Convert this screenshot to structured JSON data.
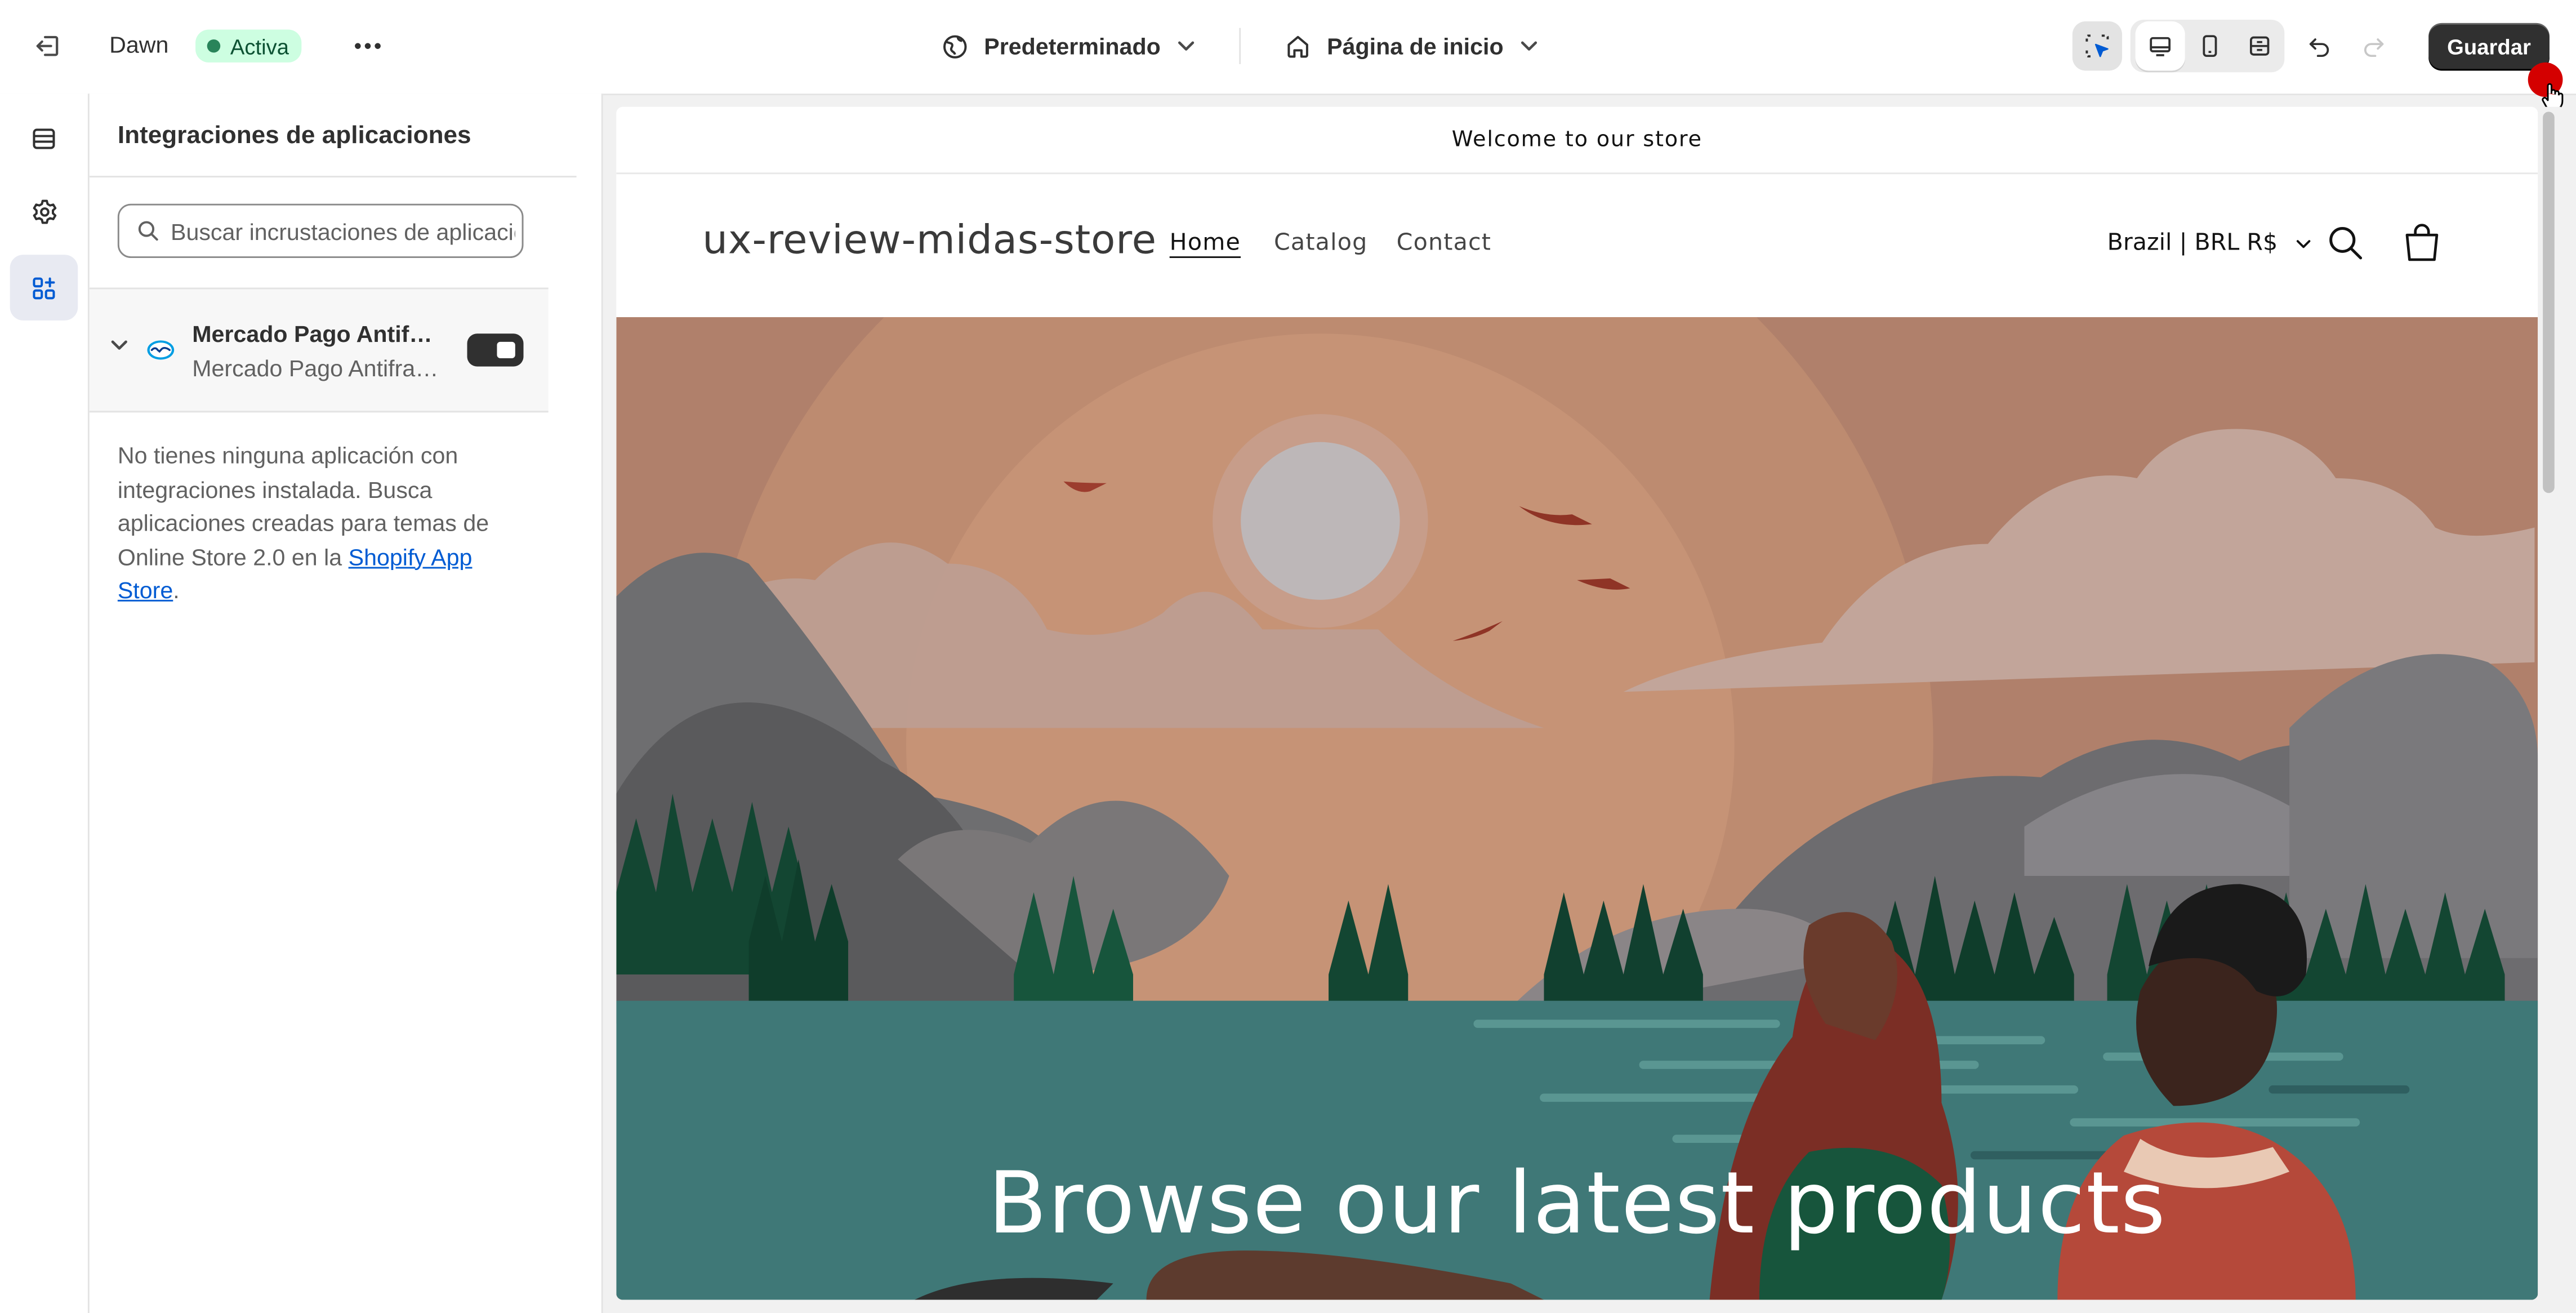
{
  "topbar": {
    "theme_name": "Dawn",
    "status_badge": "Activa",
    "template_dropdown": "Predeterminado",
    "page_dropdown": "Página de inicio",
    "save_label": "Guardar"
  },
  "sidebar_rail": {
    "items": [
      {
        "icon": "sections-icon"
      },
      {
        "icon": "settings-gear-icon"
      },
      {
        "icon": "app-embeds-icon",
        "selected": true
      }
    ]
  },
  "panel": {
    "title": "Integraciones de aplicaciones",
    "search_placeholder": "Buscar incrustaciones de aplicaciones",
    "app": {
      "name": "Mercado Pago Antifraude",
      "subtitle": "Mercado Pago Antifraude",
      "enabled": true
    },
    "empty_text_before": "No tienes ninguna aplicación con integraciones instalada. Busca aplicaciones creadas para temas de Online Store 2.0 en la ",
    "empty_link": "Shopify App Store",
    "empty_text_after": "."
  },
  "preview": {
    "announcement": "Welcome to our store",
    "store_name": "ux-review-midas-store",
    "nav": [
      "Home",
      "Catalog",
      "Contact"
    ],
    "country_selector": "Brazil | BRL R$",
    "hero_title": "Browse our latest products"
  },
  "colors": {
    "save_button": "#303030",
    "badge_bg": "#cdfee1",
    "badge_dot": "#29845a",
    "link": "#005bd3",
    "hero_sky": "#b0806b",
    "hero_water": "#3f7877"
  }
}
